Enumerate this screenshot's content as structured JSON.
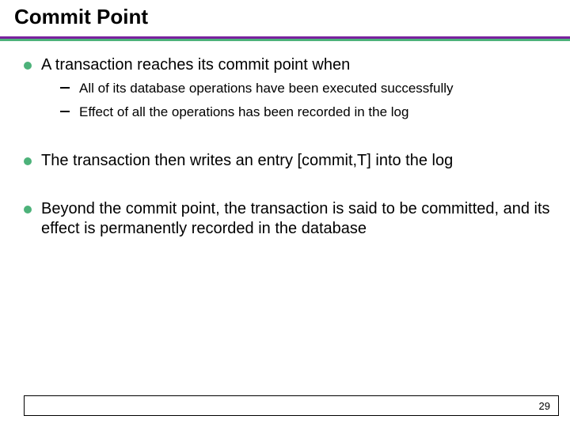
{
  "title": "Commit Point",
  "bullets": [
    {
      "text": "A transaction reaches its commit point when",
      "subs": [
        "All of its database operations have been executed successfully",
        "Effect of all the operations has been recorded in the log"
      ]
    },
    {
      "text": "The transaction then writes an entry [commit,T] into the log",
      "subs": []
    },
    {
      "text": "Beyond the commit point, the transaction is said to be committed, and its effect is permanently recorded in the database",
      "subs": []
    }
  ],
  "page_number": "29"
}
